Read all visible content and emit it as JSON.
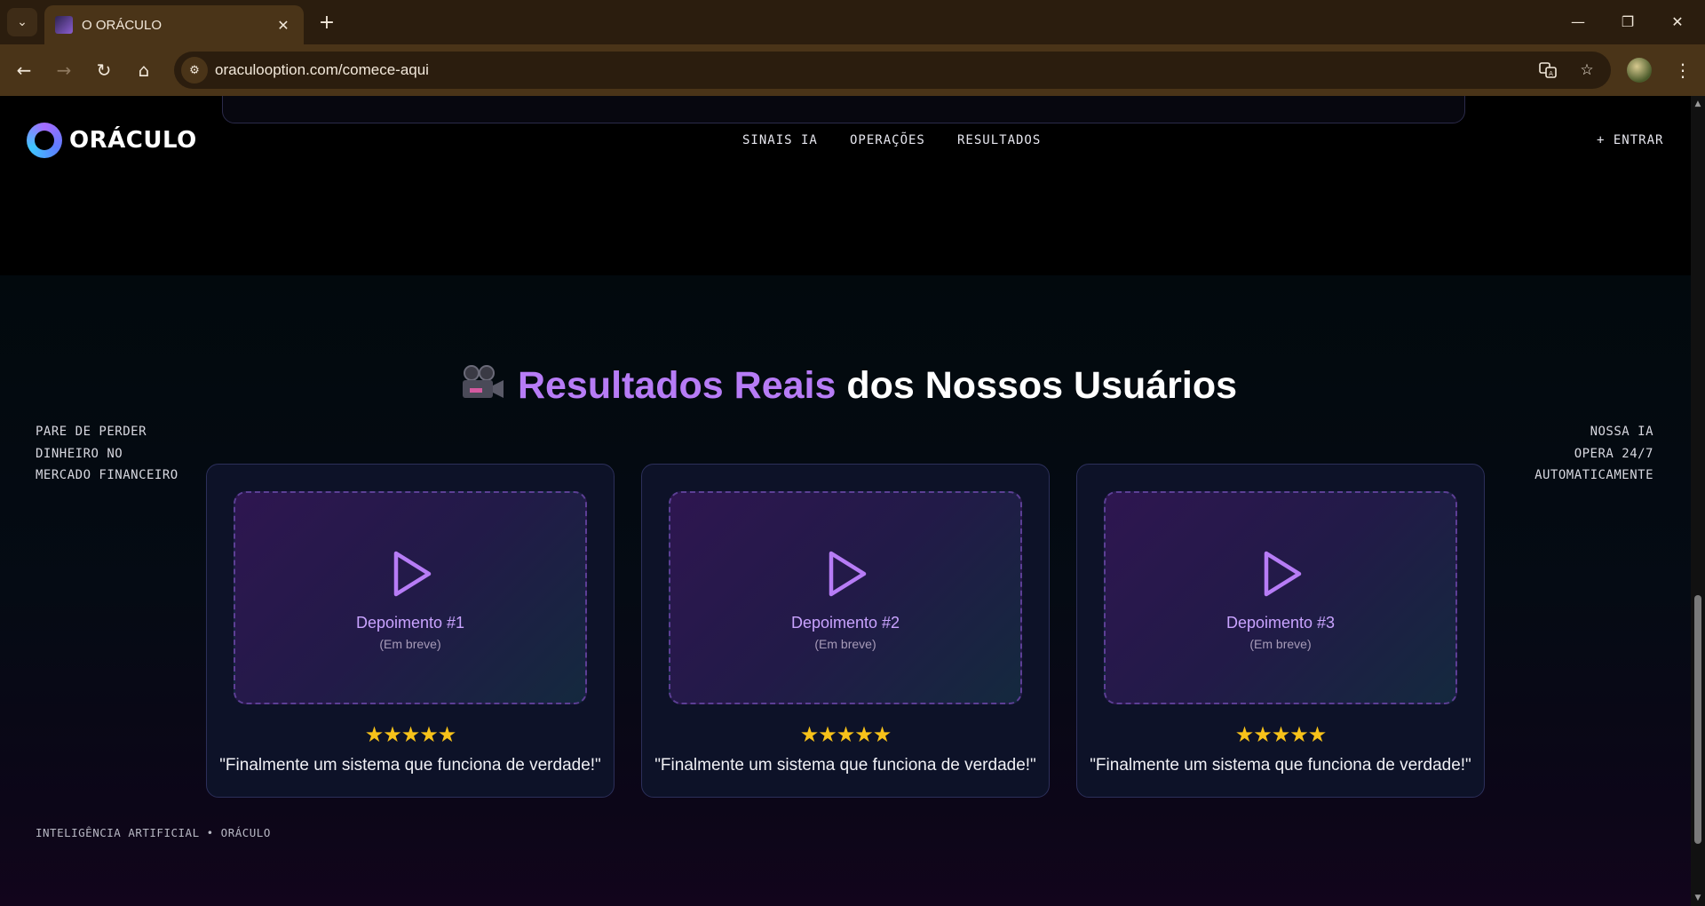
{
  "browser": {
    "tab_title": "O ORÁCULO",
    "tab_close": "✕",
    "new_tab": "+",
    "tab_search_icon": "⌄",
    "url": "oraculooption.com/comece-aqui",
    "window_controls": {
      "minimize": "—",
      "restore": "❐",
      "close": "✕"
    },
    "nav": {
      "back": "←",
      "forward": "→",
      "reload": "↻",
      "home": "⌂"
    },
    "icons": [
      "translate-icon",
      "bookmark-star-icon",
      "profile-avatar",
      "kebab-menu-icon"
    ]
  },
  "site": {
    "logo_text": "ORÁCULO",
    "nav_links": [
      "SINAIS IA",
      "OPERAÇÕES",
      "RESULTADOS"
    ],
    "enter_label": "+ ENTRAR"
  },
  "section": {
    "title_accent": "Resultados Reais",
    "title_rest": "dos Nossos Usuários",
    "side_left": [
      "PARE DE PERDER",
      "DINHEIRO NO",
      "MERCADO FINANCEIRO"
    ],
    "side_right": [
      "NOSSA IA",
      "OPERA 24/7",
      "AUTOMATICAMENTE"
    ],
    "footer_tag": "INTELIGÊNCIA ARTIFICIAL • ORÁCULO"
  },
  "testimonials": [
    {
      "title": "Depoimento #1",
      "status": "(Em breve)",
      "stars": "★★★★★",
      "rating": 5,
      "quote": "\"Finalmente um sistema que funciona de verdade!\""
    },
    {
      "title": "Depoimento #2",
      "status": "(Em breve)",
      "stars": "★★★★★",
      "rating": 5,
      "quote": "\"Finalmente um sistema que funciona de verdade!\""
    },
    {
      "title": "Depoimento #3",
      "status": "(Em breve)",
      "stars": "★★★★★",
      "rating": 5,
      "quote": "\"Finalmente um sistema que funciona de verdade!\""
    }
  ],
  "colors": {
    "accent": "#b77cf6",
    "star": "#f7c21a",
    "chrome": "#4a3418"
  }
}
